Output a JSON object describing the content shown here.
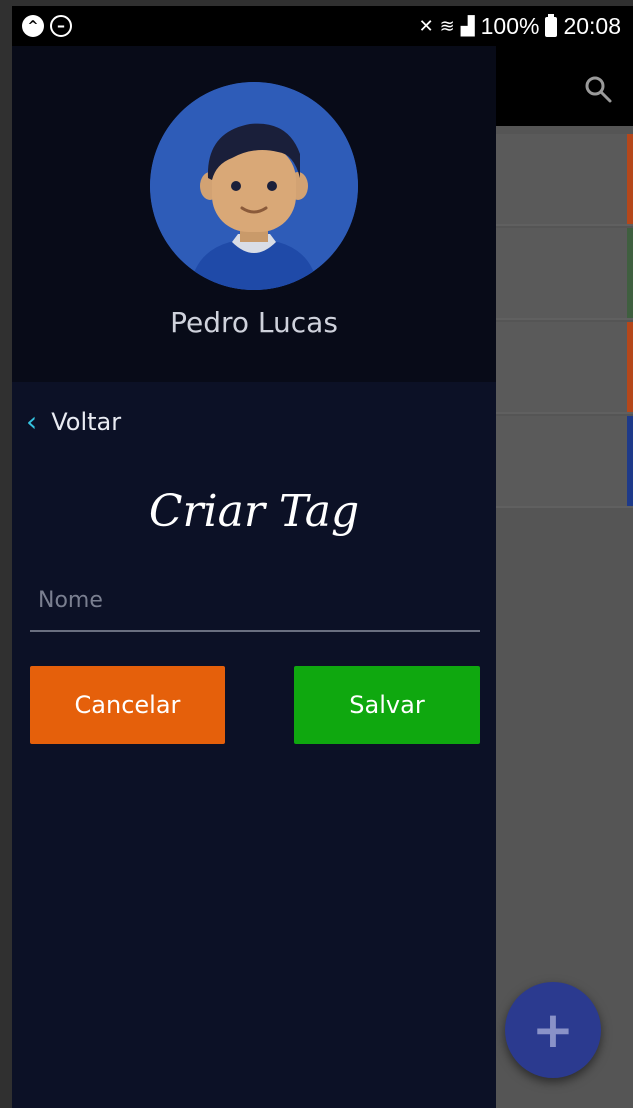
{
  "status_bar": {
    "battery": "100%",
    "time": "20:08",
    "icons": [
      "app-notification-icon",
      "do-not-disturb-icon",
      "mute-icon",
      "wifi-icon",
      "signal-icon",
      "battery-icon"
    ]
  },
  "drawer": {
    "user_name": "Pedro Lucas",
    "back_label": "Voltar",
    "form_title": "Criar Tag",
    "name_placeholder": "Nome",
    "name_value": "",
    "cancel_label": "Cancelar",
    "save_label": "Salvar"
  },
  "app": {
    "fab_symbol": "+"
  },
  "colors": {
    "drawer_bg": "#0c1126",
    "header_bg": "#080b18",
    "cancel": "#e5600b",
    "save": "#0fa80f",
    "accent_back": "#35c3e0",
    "fab": "#2b3a8f",
    "row_accents": [
      "#b5471a",
      "#3f5f3f",
      "#b5471a",
      "#1e3a8a"
    ]
  }
}
